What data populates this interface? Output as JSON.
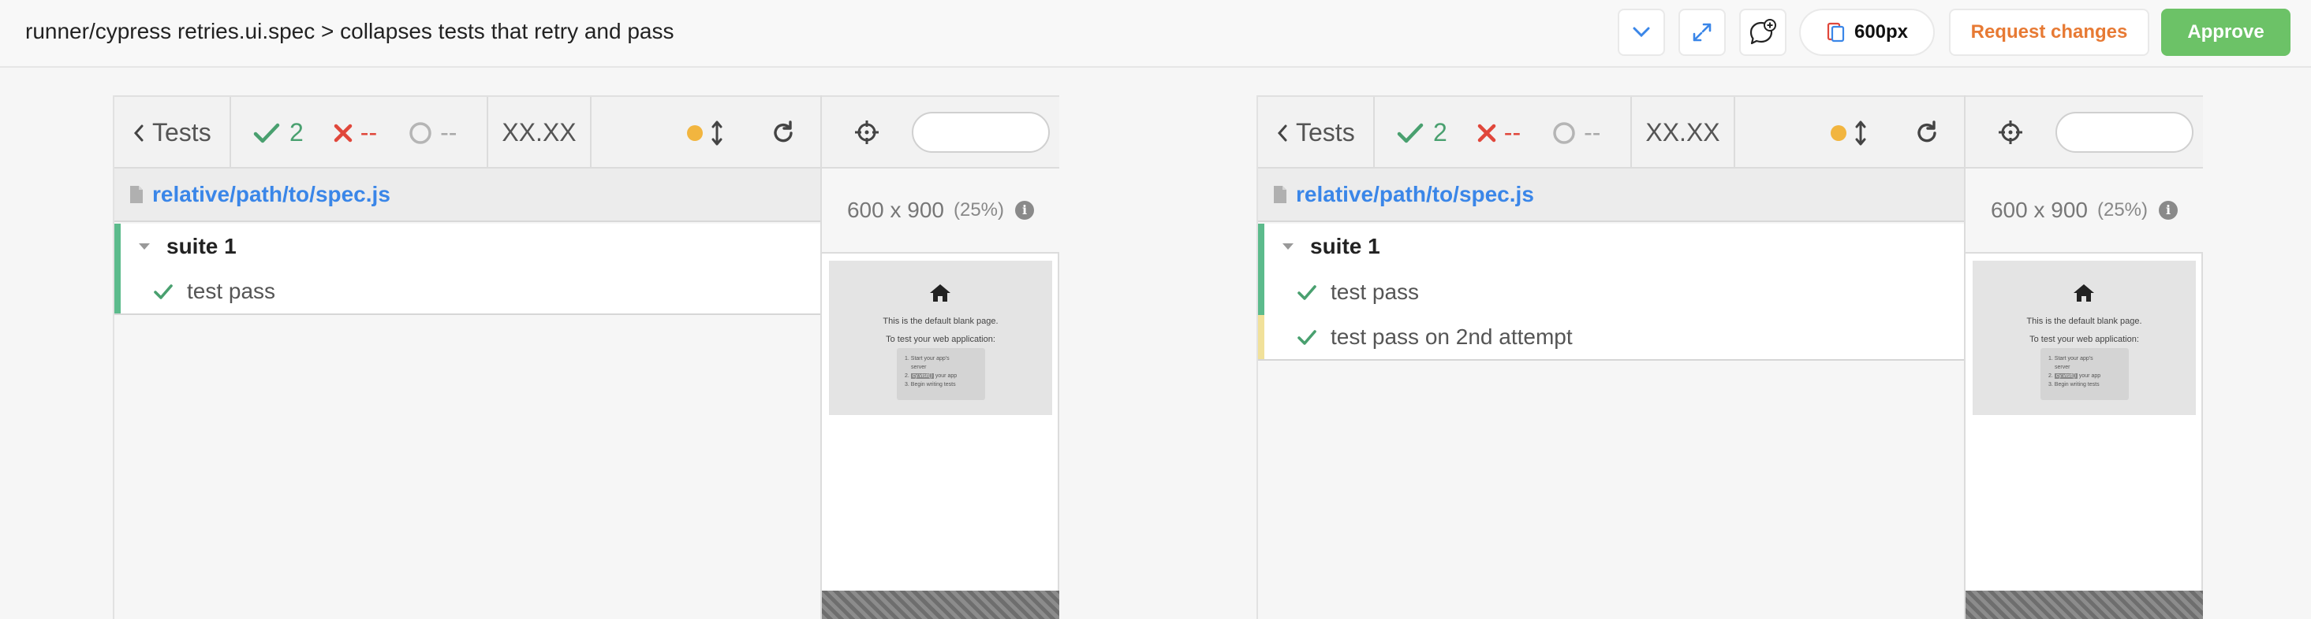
{
  "header": {
    "title": "runner/cypress retries.ui.spec > collapses tests that retry and pass",
    "viewport_label": "600px",
    "request_changes_label": "Request changes",
    "approve_label": "Approve",
    "icons": [
      "chevron-down-icon",
      "expand-icon",
      "comment-add-icon",
      "viewport-icon"
    ]
  },
  "panels": [
    {
      "toolbar": {
        "back_label": "Tests",
        "passed": "2",
        "failed": "--",
        "pending": "--",
        "duration": "XX.XX"
      },
      "spec_path": "relative/path/to/spec.js",
      "suite": "suite 1",
      "tests": [
        {
          "name": "test pass",
          "status": "passed",
          "bar_color": "#5cbb8c"
        }
      ],
      "preview": {
        "size_label": "600 x 900",
        "scale_label": "(25%)",
        "blank_title": "This is the default blank page.",
        "blank_subtitle": "To test your web application:",
        "steps": [
          "1. Start your app's",
          "server",
          "2. cy.visit() your app",
          "3. Begin writing tests"
        ],
        "highlight": "cy.visit()"
      }
    },
    {
      "toolbar": {
        "back_label": "Tests",
        "passed": "2",
        "failed": "--",
        "pending": "--",
        "duration": "XX.XX"
      },
      "spec_path": "relative/path/to/spec.js",
      "suite": "suite 1",
      "tests": [
        {
          "name": "test pass",
          "status": "passed",
          "bar_color": "#5cbb8c"
        },
        {
          "name": "test pass on 2nd attempt",
          "status": "passed",
          "bar_color": "#f1e19a"
        }
      ],
      "preview": {
        "size_label": "600 x 900",
        "scale_label": "(25%)",
        "blank_title": "This is the default blank page.",
        "blank_subtitle": "To test your web application:",
        "steps": [
          "1. Start your app's",
          "server",
          "2. cy.visit() your app",
          "3. Begin writing tests"
        ],
        "highlight": "cy.visit()"
      }
    }
  ],
  "colors": {
    "pass": "#49a06f",
    "fail": "#e0473b",
    "link": "#3a86e8",
    "approve": "#6cc267",
    "request_changes": "#e77a34",
    "running_dot": "#f2b53f"
  }
}
